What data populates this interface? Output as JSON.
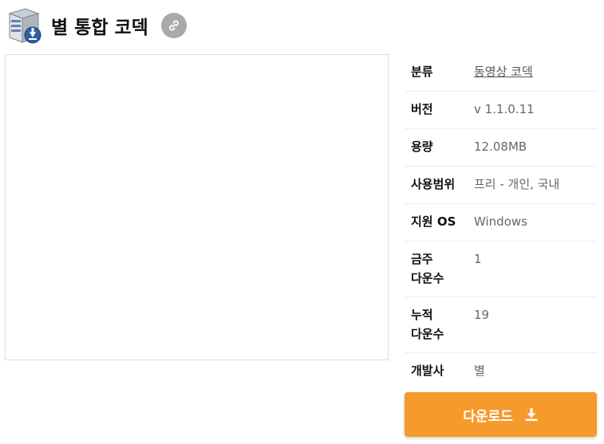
{
  "header": {
    "title": "별 통합 코덱",
    "app_icon": "software-box-icon",
    "link_icon": "link-icon"
  },
  "info": {
    "rows": [
      {
        "label": "분류",
        "value": "동영상 코덱",
        "is_link": true
      },
      {
        "label": "버전",
        "value": "v 1.1.0.11"
      },
      {
        "label": "용량",
        "value": "12.08MB"
      },
      {
        "label": "사용범위",
        "value": "프리 - 개인, 국내"
      },
      {
        "label": "지원 OS",
        "value": "Windows"
      },
      {
        "label": "금주 다운수",
        "value": "1"
      },
      {
        "label": "누적 다운수",
        "value": "19"
      },
      {
        "label": "개발사",
        "value": "별"
      }
    ]
  },
  "download": {
    "label": "다운로드",
    "icon": "download-icon"
  },
  "colors": {
    "accent": "#f59a2b",
    "link_button_bg": "#a9a9a9",
    "border": "#dcdcdc"
  }
}
